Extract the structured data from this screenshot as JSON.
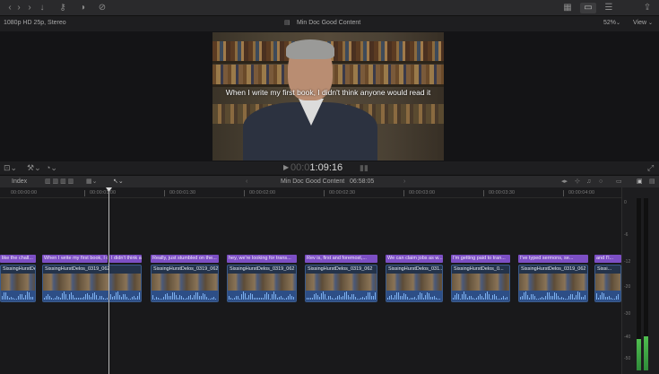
{
  "toolbar": {
    "icons": [
      "back-icon",
      "forward-icon",
      "import-icon",
      "keyword-icon",
      "color-icon",
      "tools-icon",
      "layout-icon",
      "browser-toggle-icon",
      "inspector-icon",
      "share-icon"
    ]
  },
  "viewer_header": {
    "format": "1080p HD 25p, Stereo",
    "project": "Min Doc Good Content",
    "zoom": "52%",
    "view_label": "View"
  },
  "viewer": {
    "subtitle": "When I write my first book, I didn't think anyone would read it"
  },
  "transport": {
    "timecode_dim": "00:0",
    "timecode": "1:09:16"
  },
  "timeline_header": {
    "index_label": "Index",
    "project": "Min Doc Good Content",
    "duration": "06:58:05"
  },
  "ruler": {
    "labels": [
      "00:00:00:00",
      "00:00:01:00",
      "00:00:01:30",
      "00:00:02:00",
      "00:00:02:30",
      "00:00:03:00",
      "00:00:03:30",
      "00:00:04:00",
      "00:00:05:00",
      "00:00:05:30"
    ]
  },
  "title_clips": [
    "like the chall...",
    "When I write my first book, I d...",
    "I didn't think a...",
    "Really, just stumbled on the...",
    "hey, we're looking for trans...",
    "Rev is, first and foremost,...",
    "We can claim jobs as w...",
    "I'm getting paid to tran...",
    "I've typed sermons, se...",
    "and I'l..."
  ],
  "video_clips": [
    "SissingHurstDelos_0...",
    "SissingHurstDelos_0319_062",
    "SissingHurstDelos_0319_062",
    "SissingHurstDelos_0319_062",
    "SissingHurstDelos_0319_062",
    "SissingHurstDelos_031...",
    "SissingHurstDelos_0...",
    "SissingHurstDelos_0319_062",
    "Sissi..."
  ],
  "meters": {
    "labels": [
      "0",
      "-6",
      "-12",
      "-20",
      "-30",
      "-40",
      "-50"
    ],
    "left_level": 0.18,
    "right_level": 0.2
  }
}
